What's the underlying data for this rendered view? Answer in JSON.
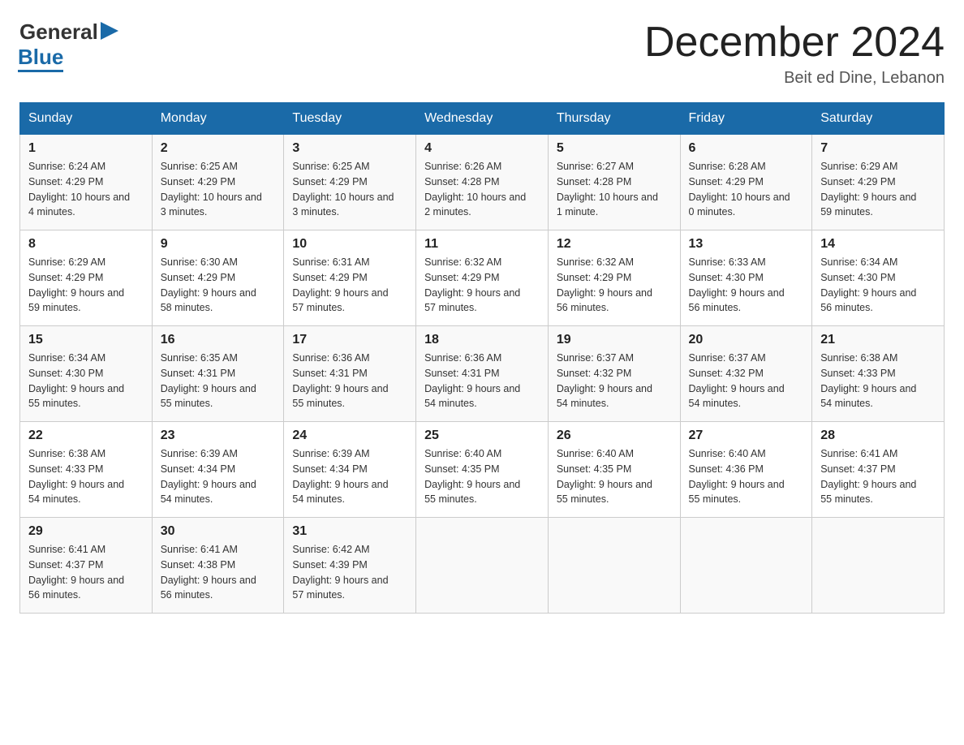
{
  "logo": {
    "general": "General",
    "blue": "Blue"
  },
  "title": "December 2024",
  "location": "Beit ed Dine, Lebanon",
  "weekdays": [
    "Sunday",
    "Monday",
    "Tuesday",
    "Wednesday",
    "Thursday",
    "Friday",
    "Saturday"
  ],
  "weeks": [
    [
      {
        "day": "1",
        "sunrise": "6:24 AM",
        "sunset": "4:29 PM",
        "daylight": "10 hours and 4 minutes."
      },
      {
        "day": "2",
        "sunrise": "6:25 AM",
        "sunset": "4:29 PM",
        "daylight": "10 hours and 3 minutes."
      },
      {
        "day": "3",
        "sunrise": "6:25 AM",
        "sunset": "4:29 PM",
        "daylight": "10 hours and 3 minutes."
      },
      {
        "day": "4",
        "sunrise": "6:26 AM",
        "sunset": "4:28 PM",
        "daylight": "10 hours and 2 minutes."
      },
      {
        "day": "5",
        "sunrise": "6:27 AM",
        "sunset": "4:28 PM",
        "daylight": "10 hours and 1 minute."
      },
      {
        "day": "6",
        "sunrise": "6:28 AM",
        "sunset": "4:29 PM",
        "daylight": "10 hours and 0 minutes."
      },
      {
        "day": "7",
        "sunrise": "6:29 AM",
        "sunset": "4:29 PM",
        "daylight": "9 hours and 59 minutes."
      }
    ],
    [
      {
        "day": "8",
        "sunrise": "6:29 AM",
        "sunset": "4:29 PM",
        "daylight": "9 hours and 59 minutes."
      },
      {
        "day": "9",
        "sunrise": "6:30 AM",
        "sunset": "4:29 PM",
        "daylight": "9 hours and 58 minutes."
      },
      {
        "day": "10",
        "sunrise": "6:31 AM",
        "sunset": "4:29 PM",
        "daylight": "9 hours and 57 minutes."
      },
      {
        "day": "11",
        "sunrise": "6:32 AM",
        "sunset": "4:29 PM",
        "daylight": "9 hours and 57 minutes."
      },
      {
        "day": "12",
        "sunrise": "6:32 AM",
        "sunset": "4:29 PM",
        "daylight": "9 hours and 56 minutes."
      },
      {
        "day": "13",
        "sunrise": "6:33 AM",
        "sunset": "4:30 PM",
        "daylight": "9 hours and 56 minutes."
      },
      {
        "day": "14",
        "sunrise": "6:34 AM",
        "sunset": "4:30 PM",
        "daylight": "9 hours and 56 minutes."
      }
    ],
    [
      {
        "day": "15",
        "sunrise": "6:34 AM",
        "sunset": "4:30 PM",
        "daylight": "9 hours and 55 minutes."
      },
      {
        "day": "16",
        "sunrise": "6:35 AM",
        "sunset": "4:31 PM",
        "daylight": "9 hours and 55 minutes."
      },
      {
        "day": "17",
        "sunrise": "6:36 AM",
        "sunset": "4:31 PM",
        "daylight": "9 hours and 55 minutes."
      },
      {
        "day": "18",
        "sunrise": "6:36 AM",
        "sunset": "4:31 PM",
        "daylight": "9 hours and 54 minutes."
      },
      {
        "day": "19",
        "sunrise": "6:37 AM",
        "sunset": "4:32 PM",
        "daylight": "9 hours and 54 minutes."
      },
      {
        "day": "20",
        "sunrise": "6:37 AM",
        "sunset": "4:32 PM",
        "daylight": "9 hours and 54 minutes."
      },
      {
        "day": "21",
        "sunrise": "6:38 AM",
        "sunset": "4:33 PM",
        "daylight": "9 hours and 54 minutes."
      }
    ],
    [
      {
        "day": "22",
        "sunrise": "6:38 AM",
        "sunset": "4:33 PM",
        "daylight": "9 hours and 54 minutes."
      },
      {
        "day": "23",
        "sunrise": "6:39 AM",
        "sunset": "4:34 PM",
        "daylight": "9 hours and 54 minutes."
      },
      {
        "day": "24",
        "sunrise": "6:39 AM",
        "sunset": "4:34 PM",
        "daylight": "9 hours and 54 minutes."
      },
      {
        "day": "25",
        "sunrise": "6:40 AM",
        "sunset": "4:35 PM",
        "daylight": "9 hours and 55 minutes."
      },
      {
        "day": "26",
        "sunrise": "6:40 AM",
        "sunset": "4:35 PM",
        "daylight": "9 hours and 55 minutes."
      },
      {
        "day": "27",
        "sunrise": "6:40 AM",
        "sunset": "4:36 PM",
        "daylight": "9 hours and 55 minutes."
      },
      {
        "day": "28",
        "sunrise": "6:41 AM",
        "sunset": "4:37 PM",
        "daylight": "9 hours and 55 minutes."
      }
    ],
    [
      {
        "day": "29",
        "sunrise": "6:41 AM",
        "sunset": "4:37 PM",
        "daylight": "9 hours and 56 minutes."
      },
      {
        "day": "30",
        "sunrise": "6:41 AM",
        "sunset": "4:38 PM",
        "daylight": "9 hours and 56 minutes."
      },
      {
        "day": "31",
        "sunrise": "6:42 AM",
        "sunset": "4:39 PM",
        "daylight": "9 hours and 57 minutes."
      },
      null,
      null,
      null,
      null
    ]
  ],
  "labels": {
    "sunrise": "Sunrise:",
    "sunset": "Sunset:",
    "daylight": "Daylight:"
  }
}
